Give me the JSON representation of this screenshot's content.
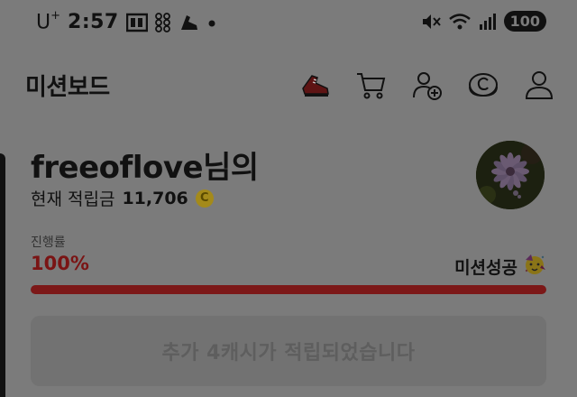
{
  "status_bar": {
    "carrier": "U",
    "carrier_sup": "+",
    "time": "2:57",
    "battery": "100",
    "icons": [
      "calendar-icon",
      "grid-dots-icon",
      "sneaker-icon",
      "dot-icon",
      "mute-icon",
      "wifi-icon",
      "signal-icon"
    ]
  },
  "header": {
    "title": "미션보드",
    "icons": [
      "sneaker-icon",
      "cart-icon",
      "add-friend-icon",
      "coin-icon",
      "profile-icon"
    ]
  },
  "profile": {
    "name": "freeoflove님의",
    "points_label": "현재 적립금",
    "points_value": "11,706",
    "coin_symbol": "C"
  },
  "progress": {
    "label": "진행률",
    "value_text": "100%",
    "value": 1.0,
    "status_text": "미션성공",
    "status_emoji": "🥳"
  },
  "message": {
    "text": "추가 4캐시가 적립되었습니다"
  },
  "colors": {
    "overlay_bg": "#7b7b7b",
    "progress_fill": "#7c1818",
    "progress_text": "#7a1414",
    "coin": "#a48a1a"
  }
}
